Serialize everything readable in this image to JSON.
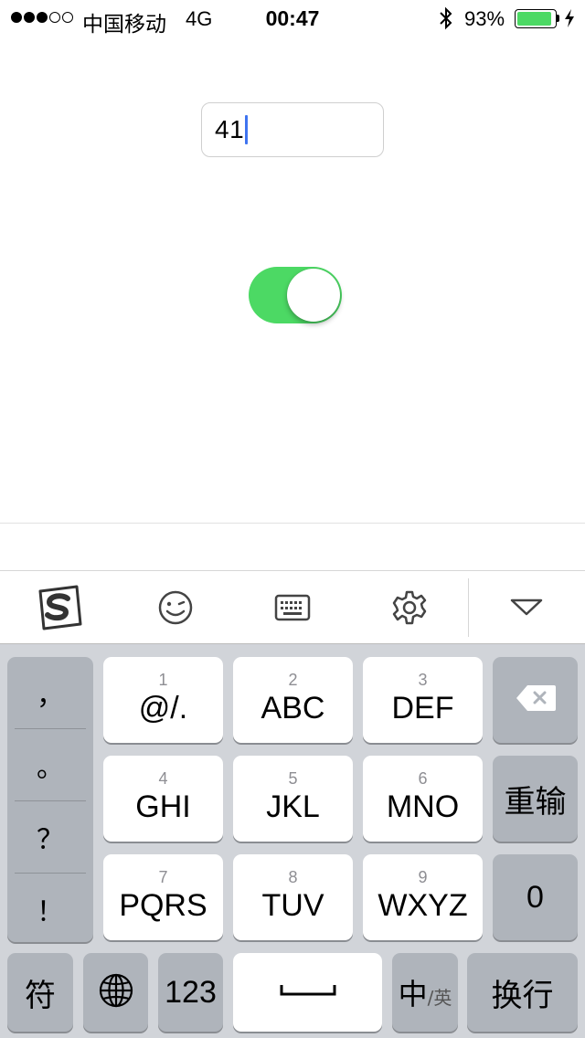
{
  "status_bar": {
    "carrier": "中国移动",
    "network": "4G",
    "time": "00:47",
    "battery_percent": "93%",
    "battery_level": 0.93,
    "signal_bars_filled": 3,
    "signal_bars_total": 5
  },
  "form": {
    "text_field_value": "41",
    "switch_on": true,
    "switch_color": "#4cd964"
  },
  "keyboard_toolbar": {
    "icons": [
      "sogou-logo-icon",
      "emoji-icon",
      "keyboard-icon",
      "settings-gear-icon",
      "hide-keyboard-chevron-icon"
    ]
  },
  "keyboard": {
    "punctuation": [
      "，",
      "。",
      "？",
      "！"
    ],
    "number_keys": [
      {
        "number": "1",
        "letters": "@/."
      },
      {
        "number": "2",
        "letters": "ABC"
      },
      {
        "number": "3",
        "letters": "DEF"
      },
      {
        "number": "4",
        "letters": "GHI"
      },
      {
        "number": "5",
        "letters": "JKL"
      },
      {
        "number": "6",
        "letters": "MNO"
      },
      {
        "number": "7",
        "letters": "PQRS"
      },
      {
        "number": "8",
        "letters": "TUV"
      },
      {
        "number": "9",
        "letters": "WXYZ"
      }
    ],
    "retype_label": "重输",
    "zero_label": "0",
    "symbol_label": "符",
    "numbers_label": "123",
    "ime_main": "中",
    "ime_sub": "/英",
    "enter_label": "换行"
  }
}
